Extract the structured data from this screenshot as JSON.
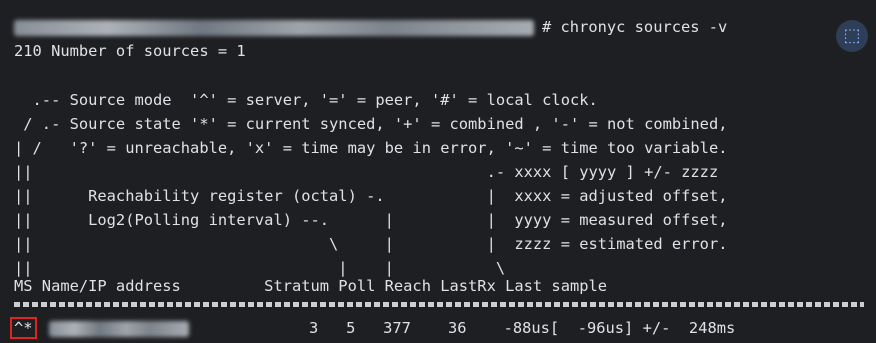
{
  "terminal": {
    "command": "# chronyc sources -v",
    "summary": "210 Number of sources = 1",
    "legend": [
      "  .-- Source mode  '^' = server, '=' = peer, '#' = local clock.",
      " / .- Source state '*' = current synced, '+' = combined , '-' = not combined,",
      "| /   '?' = unreachable, 'x' = time may be in error, '~' = time too variable.",
      "||                                                 .- xxxx [ yyyy ] +/- zzzz",
      "||      Reachability register (octal) -.           |  xxxx = adjusted offset,",
      "||      Log2(Polling interval) --.      |          |  yyyy = measured offset,",
      "||                                \\     |          |  zzzz = estimated error.",
      "||                                 |    |           \\"
    ],
    "header": "MS Name/IP address         Stratum Poll Reach LastRx Last sample",
    "rows": [
      {
        "ms": "^*",
        "rest": "             3   5   377    36    -88us[  -96us] +/-  248ms"
      }
    ]
  },
  "icons": {
    "screenshot_button": "screenshot-capture-icon"
  }
}
